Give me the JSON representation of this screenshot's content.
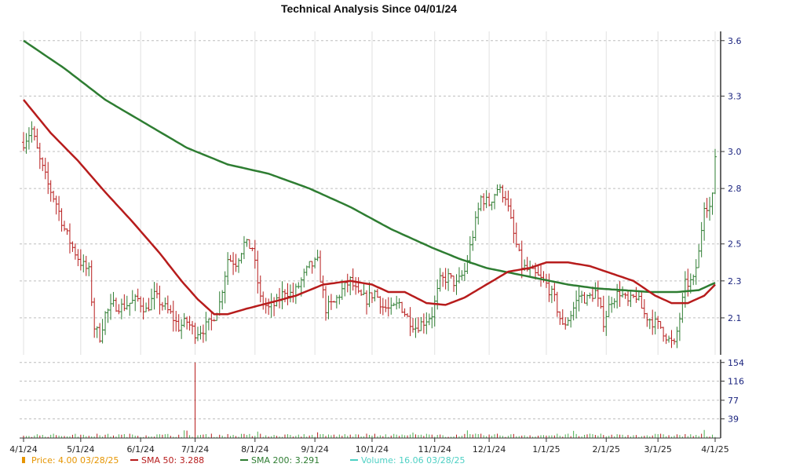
{
  "chart_data": {
    "type": "line",
    "title": "Technical Analysis Since 04/01/24",
    "price_panel": {
      "ylim": [
        1.9,
        3.65
      ],
      "y_ticks": [
        2.1,
        2.3,
        2.5,
        2.8,
        3.0,
        3.3,
        3.6
      ],
      "y_tick_labels": [
        "2.1",
        "2.3",
        "2.5",
        "2.8",
        "3.0",
        "3.3",
        "3.6"
      ],
      "grid": true,
      "x_ticks": [
        "4/1/24",
        "5/1/24",
        "6/1/24",
        "7/1/24",
        "8/1/24",
        "9/1/24",
        "10/1/24",
        "11/1/24",
        "12/1/24",
        "1/1/25",
        "2/1/25",
        "3/1/25",
        "4/1/25"
      ],
      "x_tick_index": [
        0,
        21,
        43,
        63,
        85,
        107,
        128,
        151,
        171,
        192,
        214,
        233,
        254
      ],
      "n_days": 255,
      "price_anchors": [
        [
          0,
          3.05
        ],
        [
          3,
          3.12
        ],
        [
          6,
          2.95
        ],
        [
          9,
          2.82
        ],
        [
          12,
          2.72
        ],
        [
          15,
          2.58
        ],
        [
          18,
          2.48
        ],
        [
          21,
          2.4
        ],
        [
          24,
          2.35
        ],
        [
          26,
          2.05
        ],
        [
          28,
          2.0
        ],
        [
          30,
          2.12
        ],
        [
          33,
          2.17
        ],
        [
          36,
          2.16
        ],
        [
          39,
          2.18
        ],
        [
          42,
          2.2
        ],
        [
          45,
          2.14
        ],
        [
          48,
          2.22
        ],
        [
          51,
          2.17
        ],
        [
          54,
          2.12
        ],
        [
          57,
          2.05
        ],
        [
          60,
          2.08
        ],
        [
          63,
          2.02
        ],
        [
          66,
          2.04
        ],
        [
          69,
          2.08
        ],
        [
          72,
          2.18
        ],
        [
          75,
          2.42
        ],
        [
          78,
          2.4
        ],
        [
          81,
          2.5
        ],
        [
          84,
          2.48
        ],
        [
          87,
          2.2
        ],
        [
          90,
          2.15
        ],
        [
          93,
          2.18
        ],
        [
          96,
          2.25
        ],
        [
          99,
          2.22
        ],
        [
          102,
          2.3
        ],
        [
          105,
          2.38
        ],
        [
          108,
          2.4
        ],
        [
          111,
          2.15
        ],
        [
          114,
          2.18
        ],
        [
          117,
          2.25
        ],
        [
          120,
          2.3
        ],
        [
          123,
          2.22
        ],
        [
          126,
          2.2
        ],
        [
          129,
          2.24
        ],
        [
          132,
          2.16
        ],
        [
          135,
          2.14
        ],
        [
          138,
          2.18
        ],
        [
          141,
          2.1
        ],
        [
          144,
          2.05
        ],
        [
          147,
          2.08
        ],
        [
          150,
          2.12
        ],
        [
          153,
          2.3
        ],
        [
          156,
          2.32
        ],
        [
          159,
          2.28
        ],
        [
          162,
          2.35
        ],
        [
          165,
          2.55
        ],
        [
          168,
          2.75
        ],
        [
          171,
          2.72
        ],
        [
          174,
          2.8
        ],
        [
          177,
          2.76
        ],
        [
          180,
          2.55
        ],
        [
          183,
          2.38
        ],
        [
          186,
          2.35
        ],
        [
          189,
          2.32
        ],
        [
          192,
          2.28
        ],
        [
          195,
          2.2
        ],
        [
          198,
          2.05
        ],
        [
          201,
          2.12
        ],
        [
          204,
          2.22
        ],
        [
          207,
          2.2
        ],
        [
          210,
          2.24
        ],
        [
          213,
          2.08
        ],
        [
          216,
          2.2
        ],
        [
          219,
          2.24
        ],
        [
          222,
          2.18
        ],
        [
          225,
          2.22
        ],
        [
          228,
          2.12
        ],
        [
          231,
          2.08
        ],
        [
          234,
          2.05
        ],
        [
          237,
          1.98
        ],
        [
          239,
          1.95
        ],
        [
          241,
          2.1
        ],
        [
          243,
          2.28
        ],
        [
          246,
          2.3
        ],
        [
          248,
          2.45
        ],
        [
          250,
          2.72
        ],
        [
          252,
          2.7
        ],
        [
          253,
          2.75
        ],
        [
          254,
          2.98
        ]
      ],
      "series": [
        {
          "name": "Price",
          "legend_text": "Price: 4.00  03/28/25",
          "color": "#e69500",
          "style": "ohlc"
        },
        {
          "name": "SMA 50",
          "legend_text": "SMA 50: 3.288",
          "color": "#b71c1c",
          "anchors": [
            [
              0,
              3.28
            ],
            [
              10,
              3.1
            ],
            [
              20,
              2.95
            ],
            [
              30,
              2.78
            ],
            [
              40,
              2.62
            ],
            [
              50,
              2.45
            ],
            [
              58,
              2.3
            ],
            [
              64,
              2.2
            ],
            [
              70,
              2.12
            ],
            [
              75,
              2.12
            ],
            [
              82,
              2.15
            ],
            [
              90,
              2.18
            ],
            [
              100,
              2.22
            ],
            [
              110,
              2.28
            ],
            [
              120,
              2.3
            ],
            [
              128,
              2.28
            ],
            [
              134,
              2.24
            ],
            [
              140,
              2.24
            ],
            [
              148,
              2.18
            ],
            [
              155,
              2.17
            ],
            [
              162,
              2.21
            ],
            [
              170,
              2.28
            ],
            [
              178,
              2.35
            ],
            [
              186,
              2.37
            ],
            [
              192,
              2.4
            ],
            [
              200,
              2.4
            ],
            [
              208,
              2.38
            ],
            [
              216,
              2.34
            ],
            [
              224,
              2.3
            ],
            [
              232,
              2.22
            ],
            [
              238,
              2.18
            ],
            [
              244,
              2.18
            ],
            [
              250,
              2.22
            ],
            [
              254,
              2.28
            ]
          ]
        },
        {
          "name": "SMA 200",
          "legend_text": "SMA 200: 3.291",
          "color": "#2e7d32",
          "anchors": [
            [
              0,
              3.6
            ],
            [
              15,
              3.45
            ],
            [
              30,
              3.28
            ],
            [
              45,
              3.15
            ],
            [
              60,
              3.02
            ],
            [
              75,
              2.93
            ],
            [
              90,
              2.88
            ],
            [
              105,
              2.8
            ],
            [
              120,
              2.7
            ],
            [
              135,
              2.58
            ],
            [
              150,
              2.48
            ],
            [
              160,
              2.42
            ],
            [
              170,
              2.37
            ],
            [
              180,
              2.34
            ],
            [
              190,
              2.31
            ],
            [
              200,
              2.28
            ],
            [
              210,
              2.26
            ],
            [
              220,
              2.25
            ],
            [
              230,
              2.24
            ],
            [
              240,
              2.24
            ],
            [
              248,
              2.25
            ],
            [
              254,
              2.29
            ]
          ]
        }
      ]
    },
    "volume_panel": {
      "ylim": [
        0,
        160
      ],
      "y_ticks": [
        39,
        77,
        116,
        154
      ],
      "y_tick_labels": [
        "39",
        "77",
        "116",
        "154"
      ],
      "spike_index": 63,
      "spike_value": 154,
      "legend_text": "Volume: 16.06  03/28/25",
      "color": "#4caf50",
      "legend_color": "#4dd0c4"
    }
  },
  "legend": [
    {
      "key": "price",
      "text": "Price: 4.00  03/28/25",
      "color": "#e69500"
    },
    {
      "key": "sma50",
      "text": "SMA 50: 3.288",
      "color": "#b71c1c"
    },
    {
      "key": "sma200",
      "text": "SMA 200: 3.291",
      "color": "#2e7d32"
    },
    {
      "key": "volume",
      "text": "Volume: 16.06  03/28/25",
      "color": "#4dd0c4"
    }
  ]
}
